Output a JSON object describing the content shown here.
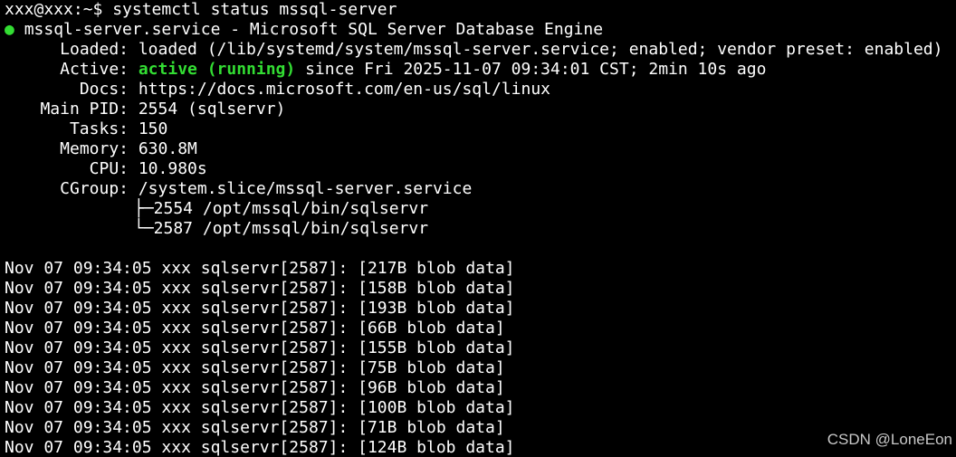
{
  "prompt": "xxx@xxx:~$ systemctl status mssql-server",
  "service": {
    "dot": "●",
    "header": "mssql-server.service - Microsoft SQL Server Database Engine",
    "loaded_label": "Loaded:",
    "loaded_value": "loaded (/lib/systemd/system/mssql-server.service; enabled; vendor preset: enabled)",
    "active_label": "Active:",
    "active_state": "active (running)",
    "active_since": " since Fri 2025-11-07 09:34:01 CST; 2min 10s ago",
    "docs_label": "Docs:",
    "docs_value": "https://docs.microsoft.com/en-us/sql/linux",
    "mainpid_label": "Main PID:",
    "mainpid_value": "2554 (sqlservr)",
    "tasks_label": "Tasks:",
    "tasks_value": "150",
    "memory_label": "Memory:",
    "memory_value": "630.8M",
    "cpu_label": "CPU:",
    "cpu_value": "10.980s",
    "cgroup_label": "CGroup:",
    "cgroup_value": "/system.slice/mssql-server.service",
    "cgroup_tree": [
      "├─2554 /opt/mssql/bin/sqlservr",
      "└─2587 /opt/mssql/bin/sqlservr"
    ]
  },
  "log_lines": [
    "Nov 07 09:34:05 xxx sqlservr[2587]: [217B blob data]",
    "Nov 07 09:34:05 xxx sqlservr[2587]: [158B blob data]",
    "Nov 07 09:34:05 xxx sqlservr[2587]: [193B blob data]",
    "Nov 07 09:34:05 xxx sqlservr[2587]: [66B blob data]",
    "Nov 07 09:34:05 xxx sqlservr[2587]: [155B blob data]",
    "Nov 07 09:34:05 xxx sqlservr[2587]: [75B blob data]",
    "Nov 07 09:34:05 xxx sqlservr[2587]: [96B blob data]",
    "Nov 07 09:34:05 xxx sqlservr[2587]: [100B blob data]",
    "Nov 07 09:34:05 xxx sqlservr[2587]: [71B blob data]",
    "Nov 07 09:34:05 xxx sqlservr[2587]: [124B blob data]"
  ],
  "watermark": "CSDN @LoneEon",
  "colors": {
    "background": "#000000",
    "text": "#ffffff",
    "active_green": "#33dd33"
  }
}
